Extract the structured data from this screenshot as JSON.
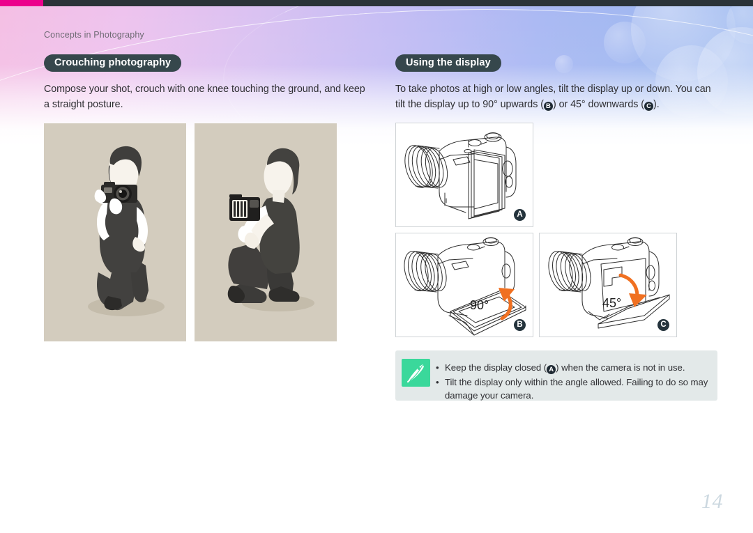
{
  "topbar": {
    "accent_color": "#ec008c",
    "bar_color": "#2b3338"
  },
  "breadcrumb": "Concepts in Photography",
  "page_number": "14",
  "left": {
    "heading": "Crouching photography",
    "body_line1": "Compose your shot, crouch with one knee touching the ground, and keep",
    "body_line2": "a straight posture.",
    "figures": [
      {
        "name": "crouching-photographer-front",
        "background": "#d3ccbe"
      },
      {
        "name": "crouching-photographer-side",
        "background": "#d3ccbe"
      }
    ]
  },
  "right": {
    "heading": "Using the display",
    "body_part1": "To take photos at high or low angles, tilt the display up or down. You can",
    "body_part2": "tilt the display up to 90° upwards (",
    "badge_b": "B",
    "body_part3": ") or 45° downwards (",
    "badge_c": "C",
    "body_part4": ").",
    "panels": [
      {
        "id": "A",
        "caption_label": "A",
        "angle": "",
        "description": "camera with display closed"
      },
      {
        "id": "B",
        "caption_label": "B",
        "angle": "90°",
        "description": "display tilted 90 degrees upwards"
      },
      {
        "id": "C",
        "caption_label": "C",
        "angle": "45°",
        "description": "display tilted 45 degrees downwards"
      }
    ],
    "note": {
      "icon_name": "pen-note-icon",
      "icon_color": "#3ad89b",
      "background": "#e3e9e9",
      "items": [
        {
          "bullet": "•",
          "pre": "Keep the display closed (",
          "badge": "A",
          "post": ") when the camera is not in use."
        },
        {
          "bullet": "•",
          "pre": "Tilt the display only within the angle allowed. Failing to do so may damage your camera.",
          "badge": "",
          "post": ""
        }
      ]
    }
  }
}
